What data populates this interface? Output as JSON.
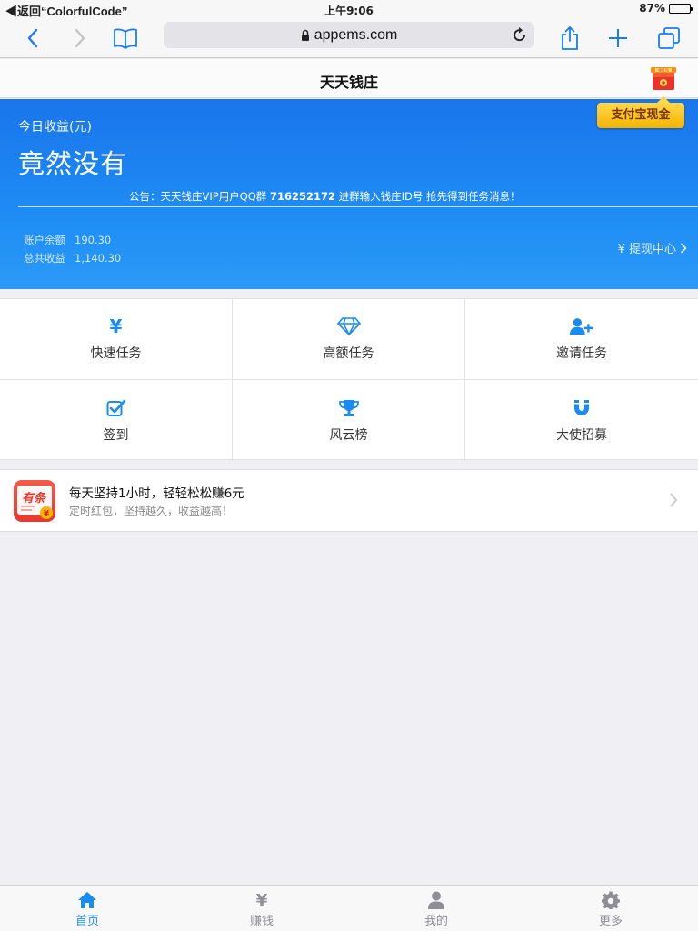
{
  "status_bar": {
    "back_label": "◀返回“ColorfulCode”",
    "time": "上午9:06",
    "battery": "87%",
    "battery_level": 0.87
  },
  "browser": {
    "url": "appems.com"
  },
  "header": {
    "title": "天天钱庄",
    "promo_badge_text": "支付宝现金",
    "redpack_label": "领红包"
  },
  "hero": {
    "today_label": "今日收益(元)",
    "today_value": "竟然没有",
    "notice_prefix": "公告：天天钱庄VIP用户QQ群 ",
    "notice_qq": "716252172",
    "notice_suffix": " 进群输入钱庄ID号 抢先得到任务消息！",
    "balance_label": "账户余额",
    "balance_value": "190.30",
    "total_label": "总共收益",
    "total_value": "1,140.30",
    "withdraw_label": "¥ 提现中心"
  },
  "grid": [
    {
      "label": "快速任务",
      "icon": "yen-icon"
    },
    {
      "label": "高额任务",
      "icon": "diamond-icon"
    },
    {
      "label": "邀请任务",
      "icon": "user-plus-icon"
    },
    {
      "label": "签到",
      "icon": "checkbox-icon"
    },
    {
      "label": "风云榜",
      "icon": "trophy-icon"
    },
    {
      "label": "大使招募",
      "icon": "magnet-icon"
    }
  ],
  "ad": {
    "title": "每天坚持1小时，轻轻松松赚6元",
    "subtitle": "定时红包，坚持越久，收益越高！",
    "logo_text": "有条"
  },
  "tabbar": [
    {
      "label": "首页",
      "icon": "home-icon",
      "active": true
    },
    {
      "label": "赚钱",
      "icon": "yen-icon",
      "active": false
    },
    {
      "label": "我的",
      "icon": "person-icon",
      "active": false
    },
    {
      "label": "更多",
      "icon": "gear-icon",
      "active": false
    }
  ],
  "colors": {
    "accent": "#1a8cf0",
    "hero_top": "#1a75ec",
    "hero_bottom": "#2b9af7",
    "badge": "#ffd84a"
  }
}
